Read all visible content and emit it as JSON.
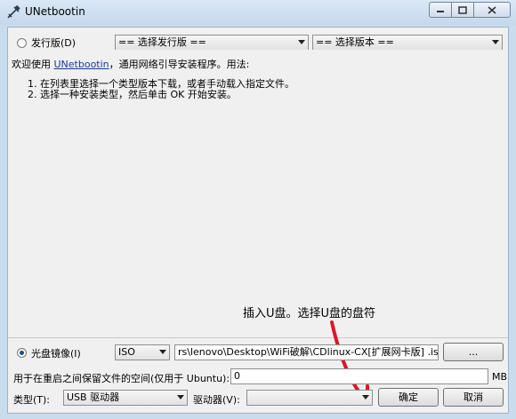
{
  "window": {
    "title": "UNetbootin"
  },
  "distro": {
    "radio_label": "发行版(D)",
    "distribution_select": "== 选择发行版 ==",
    "version_select": "== 选择版本 =="
  },
  "info": {
    "intro_prefix": "欢迎使用",
    "intro_link": "UNetbootin",
    "intro_suffix": "，通用网络引导安装程序。用法:",
    "step1": "1. 在列表里选择一个类型版本下载，或者手动载入指定文件。",
    "step2": "2. 选择一种安装类型，然后单击 OK 开始安装。"
  },
  "annotation": {
    "text": "插入U盘。选择U盘的盘符"
  },
  "diskimage": {
    "radio_label": "光盘镜像(I)",
    "format_select": "ISO",
    "path_value": "rs\\lenovo\\Desktop\\WiFi破解\\CDlinux-CX[扩展网卡版] .iso",
    "browse_label": "..."
  },
  "persist": {
    "label": "用于在重启之间保留文件的空间(仅用于 Ubuntu):",
    "value": "0",
    "unit": "MB"
  },
  "bottom": {
    "type_label": "类型(T):",
    "type_select": "USB 驱动器",
    "drive_label": "驱动器(V):",
    "drive_select": "",
    "ok_label": "确定",
    "cancel_label": "取消"
  },
  "colors": {
    "accent_arrow": "#e0142a",
    "link": "#1a3a9c"
  }
}
